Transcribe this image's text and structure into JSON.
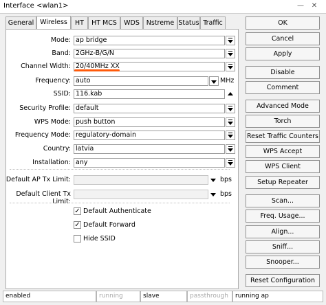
{
  "window": {
    "title": "Interface <wlan1>"
  },
  "tabs": [
    "General",
    "Wireless",
    "HT",
    "HT MCS",
    "WDS",
    "Nstreme",
    "Status",
    "Traffic"
  ],
  "form": {
    "mode_label": "Mode:",
    "mode_value": "ap bridge",
    "band_label": "Band:",
    "band_value": "2GHz-B/G/N",
    "channel_width_label": "Channel Width:",
    "channel_width_value": "20/40MHz XX",
    "frequency_label": "Frequency:",
    "frequency_value": "auto",
    "frequency_unit": "MHz",
    "ssid_label": "SSID:",
    "ssid_value": "116.kab",
    "security_profile_label": "Security Profile:",
    "security_profile_value": "default",
    "wps_mode_label": "WPS Mode:",
    "wps_mode_value": "push button",
    "frequency_mode_label": "Frequency Mode:",
    "frequency_mode_value": "regulatory-domain",
    "country_label": "Country:",
    "country_value": "latvia",
    "installation_label": "Installation:",
    "installation_value": "any",
    "ap_tx_limit_label": "Default AP Tx Limit:",
    "ap_tx_limit_unit": "bps",
    "client_tx_limit_label": "Default Client Tx Limit:",
    "client_tx_limit_unit": "bps",
    "default_authenticate_label": "Default Authenticate",
    "default_forward_label": "Default Forward",
    "hide_ssid_label": "Hide SSID",
    "default_authenticate_checked": true,
    "default_forward_checked": true,
    "hide_ssid_checked": false
  },
  "buttons": {
    "ok": "OK",
    "cancel": "Cancel",
    "apply": "Apply",
    "disable": "Disable",
    "comment": "Comment",
    "advanced_mode": "Advanced Mode",
    "torch": "Torch",
    "reset_traffic_counters": "Reset Traffic Counters",
    "wps_accept": "WPS Accept",
    "wps_client": "WPS Client",
    "setup_repeater": "Setup Repeater",
    "scan": "Scan...",
    "freq_usage": "Freq. Usage...",
    "align": "Align...",
    "sniff": "Sniff...",
    "snooper": "Snooper...",
    "reset_configuration": "Reset Configuration"
  },
  "status_bar": {
    "state": "enabled",
    "running": "running",
    "slave": "slave",
    "passthrough": "passthrough",
    "running_mode": "running ap"
  },
  "colors": {
    "highlight_underline": "#ff5a0a"
  }
}
